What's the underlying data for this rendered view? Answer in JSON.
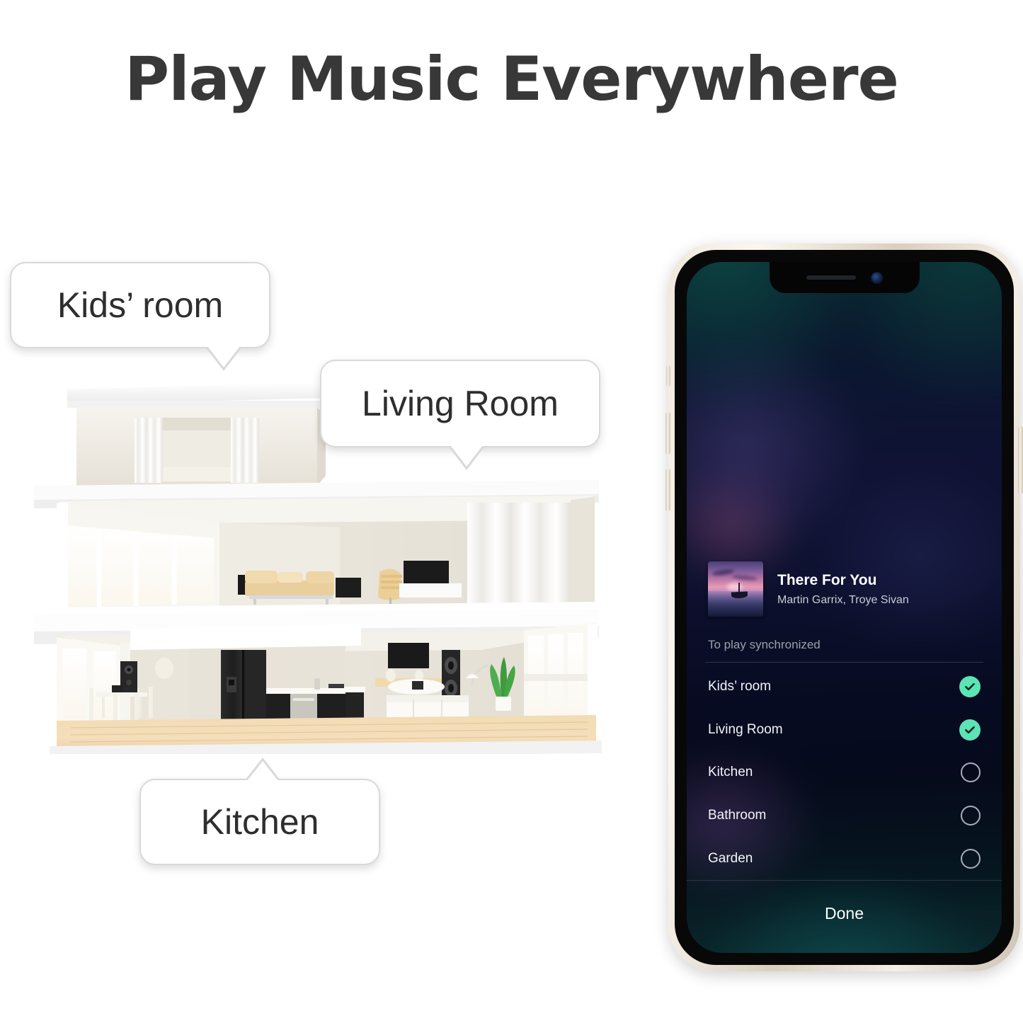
{
  "headline": "Play Music Everywhere",
  "bubbles": [
    {
      "id": "kids",
      "label": "Kids’ room"
    },
    {
      "id": "living",
      "label": "Living Room"
    },
    {
      "id": "kitchen",
      "label": "Kitchen"
    }
  ],
  "house": {
    "alt": "Cutaway dollhouse view of a two-storey home with kids' room upstairs, living room and kitchen downstairs"
  },
  "phone": {
    "hardware": {
      "speaker_grille": "speaker-grille",
      "front_camera": "front-camera-icon",
      "mute_switch": "mute-switch-button",
      "volume_up": "volume-up-button",
      "volume_down": "volume-down-button",
      "power": "power-button"
    },
    "now_playing": {
      "album_art": "album-artwork-sunset-boat",
      "title": "There For You",
      "artist": "Martin Garrix, Troye Sivan"
    },
    "section_label": "To play synchronized",
    "rooms": [
      {
        "name": "Kids’ room",
        "selected": true
      },
      {
        "name": "Living Room",
        "selected": true
      },
      {
        "name": "Kitchen",
        "selected": false
      },
      {
        "name": "Bathroom",
        "selected": false
      },
      {
        "name": "Garden",
        "selected": false
      }
    ],
    "done_label": "Done"
  },
  "colors": {
    "page_background": "#ffffff",
    "headline_text": "#383838",
    "bubble_fill": "#ffffff",
    "bubble_border": "#d9d9d9",
    "bubble_text": "#2e2e2e",
    "accent_check": "#5ce4b5",
    "screen_text": "#ffffff",
    "screen_muted_text": "#9aa0aa",
    "unselected_ring": "#a7adb8",
    "phone_frame": "#ece4d6"
  }
}
